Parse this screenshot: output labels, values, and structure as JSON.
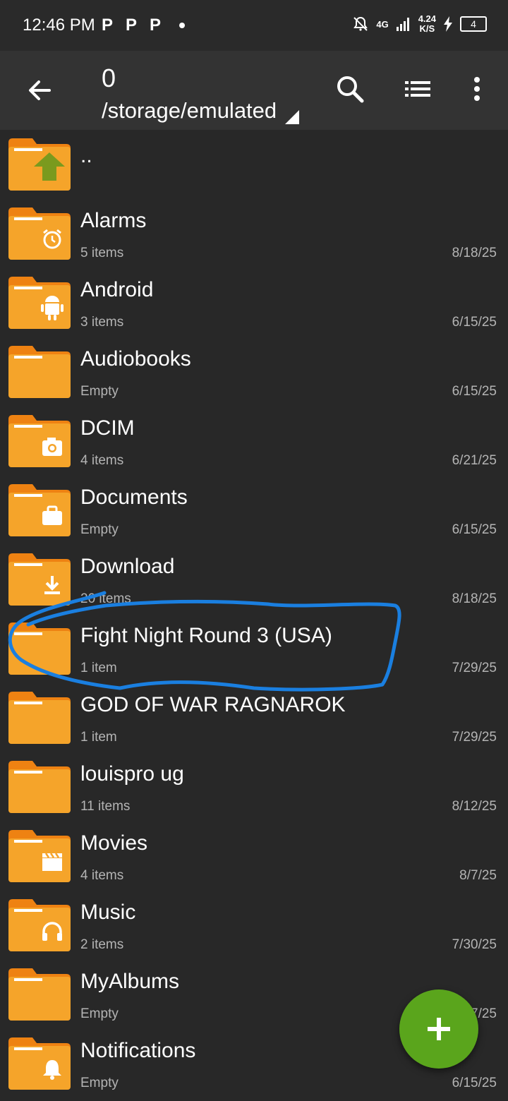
{
  "status_bar": {
    "time": "12:46 PM",
    "app_icons": [
      "P",
      "P",
      "P"
    ],
    "network": "4G",
    "speed": "4.24",
    "speed_unit": "K/S",
    "battery": "4"
  },
  "toolbar": {
    "count": "0",
    "path": "/storage/emulated",
    "icons": [
      "back-arrow-icon",
      "search-icon",
      "list-view-icon",
      "more-vert-icon"
    ]
  },
  "parent_entry": {
    "label": ".."
  },
  "folders": [
    {
      "name": "Alarms",
      "items": "5 items",
      "date": "8/18/25",
      "badge": "alarm"
    },
    {
      "name": "Android",
      "items": "3 items",
      "date": "6/15/25",
      "badge": "android"
    },
    {
      "name": "Audiobooks",
      "items": "Empty",
      "date": "6/15/25",
      "badge": ""
    },
    {
      "name": "DCIM",
      "items": "4 items",
      "date": "6/21/25",
      "badge": "camera"
    },
    {
      "name": "Documents",
      "items": "Empty",
      "date": "6/15/25",
      "badge": "briefcase"
    },
    {
      "name": "Download",
      "items": "20 items",
      "date": "8/18/25",
      "badge": "download"
    },
    {
      "name": "Fight Night Round 3 (USA)",
      "items": "1 item",
      "date": "7/29/25",
      "badge": ""
    },
    {
      "name": "GOD OF WAR RAGNAROK",
      "items": "1 item",
      "date": "7/29/25",
      "badge": ""
    },
    {
      "name": "louispro ug",
      "items": "11 items",
      "date": "8/12/25",
      "badge": ""
    },
    {
      "name": "Movies",
      "items": "4 items",
      "date": "8/7/25",
      "badge": "movie"
    },
    {
      "name": "Music",
      "items": "2 items",
      "date": "7/30/25",
      "badge": "headphones"
    },
    {
      "name": "MyAlbums",
      "items": "Empty",
      "date": "8/7/25",
      "badge": ""
    },
    {
      "name": "Notifications",
      "items": "Empty",
      "date": "6/15/25",
      "badge": "bell"
    }
  ],
  "fab": {
    "icon": "plus-icon"
  },
  "colors": {
    "folder_body": "#F5A42A",
    "folder_tab": "#EE8212",
    "parent_arrow": "#7A9A1E",
    "fab": "#5AA51C",
    "annotation": "#1A7FE0"
  }
}
